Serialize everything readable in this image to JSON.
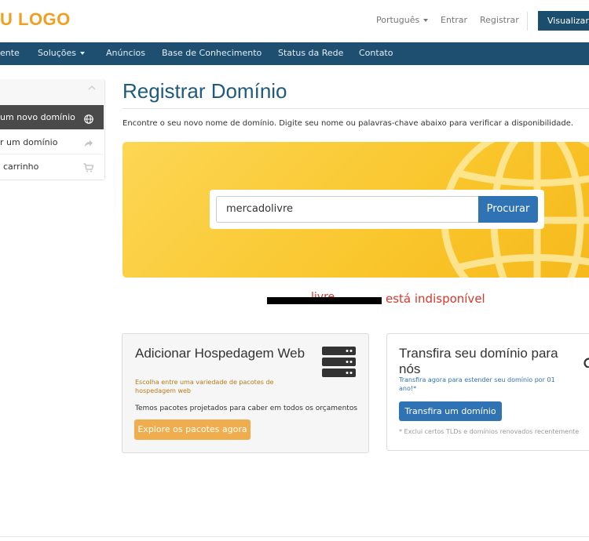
{
  "header": {
    "logo": "U LOGO",
    "language": "Português",
    "login": "Entrar",
    "register": "Registrar",
    "view_cart": "Visualizar"
  },
  "nav": {
    "items": [
      {
        "label": "ente"
      },
      {
        "label": "Soluções"
      },
      {
        "label": "Anúncios"
      },
      {
        "label": "Base de Conhecimento"
      },
      {
        "label": "Status da Rede"
      },
      {
        "label": "Contato"
      }
    ]
  },
  "sidebar": {
    "items": [
      {
        "label": "um novo domínio",
        "icon": "globe-icon",
        "active": true
      },
      {
        "label": "r um domínio",
        "icon": "share-icon"
      },
      {
        "label": "carrinho",
        "icon": "cart-icon"
      }
    ]
  },
  "main": {
    "title": "Registrar Domínio",
    "intro": "Encontre o seu novo nome de domínio. Digite seu nome ou palavras-chave abaixo para verificar a disponibilidade.",
    "search": {
      "value": "mercadolivre",
      "button": "Procurar"
    },
    "result": {
      "domain_fragment": "livre",
      "message": "está indisponível"
    }
  },
  "cards": {
    "hosting": {
      "title": "Adicionar Hospedagem Web",
      "subtitle": "Escolha entre uma variedade de pacotes de hospedagem web",
      "body": "Temos pacotes projetados para caber em todos os orçamentos",
      "button": "Explore os pacotes agora",
      "icon": "server-icon"
    },
    "transfer": {
      "title": "Transfira seu domínio para nós",
      "subtitle": "Transfira agora para estender seu domínio por 01 ano!*",
      "button": "Transfira um domínio",
      "note": "* Exclui certos TLDs e domínios renovados recentemente"
    }
  },
  "colors": {
    "navbar": "#1e4e70",
    "primary": "#2f73b4",
    "logo": "#f0a020",
    "hero": "#f9c62c",
    "error": "#d9372b",
    "orange_button": "#f0ad4e"
  }
}
